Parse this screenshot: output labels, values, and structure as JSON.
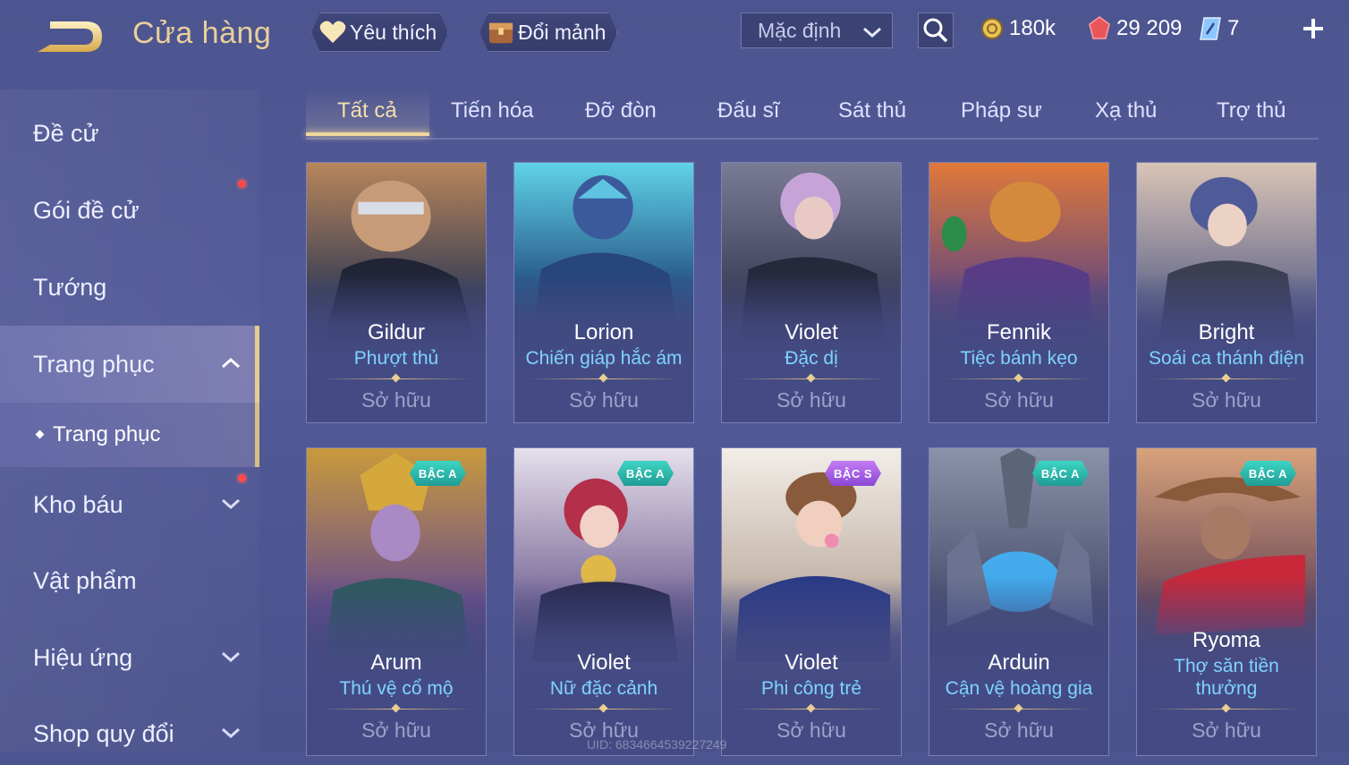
{
  "header": {
    "title": "Cửa hàng",
    "favorites_label": "Yêu thích",
    "exchange_label": "Đổi mảnh",
    "sort_value": "Mặc định",
    "currencies": [
      {
        "name": "gold",
        "value": "180k",
        "color": "#e9c35a"
      },
      {
        "name": "vouchers",
        "value": "29 209",
        "color": "#e8565a"
      },
      {
        "name": "tickets",
        "value": "7",
        "color": "#8ec7ff"
      }
    ]
  },
  "sidebar": {
    "items": [
      {
        "label": "Đề cử"
      },
      {
        "label": "Gói đề cử"
      },
      {
        "label": "Tướng"
      },
      {
        "label": "Trang phục"
      },
      {
        "label": "Kho báu"
      },
      {
        "label": "Vật phẩm"
      },
      {
        "label": "Hiệu ứng"
      },
      {
        "label": "Shop quy đổi"
      }
    ],
    "sub_item": "Trang phục"
  },
  "tabs": [
    "Tất cả",
    "Tiến hóa",
    "Đỡ đòn",
    "Đấu sĩ",
    "Sát thủ",
    "Pháp sư",
    "Xạ thủ",
    "Trợ thủ"
  ],
  "cards": [
    {
      "hero": "Gildur",
      "skin": "Phượt thủ",
      "status": "Sở hữu",
      "badge": ""
    },
    {
      "hero": "Lorion",
      "skin": "Chiến giáp hắc ám",
      "status": "Sở hữu",
      "badge": ""
    },
    {
      "hero": "Violet",
      "skin": "Đặc dị",
      "status": "Sở hữu",
      "badge": ""
    },
    {
      "hero": "Fennik",
      "skin": "Tiệc bánh kẹo",
      "status": "Sở hữu",
      "badge": ""
    },
    {
      "hero": "Bright",
      "skin": "Soái ca thánh điện",
      "status": "Sở hữu",
      "badge": ""
    },
    {
      "hero": "Arum",
      "skin": "Thú vệ cổ mộ",
      "status": "Sở hữu",
      "badge": "BẬC A"
    },
    {
      "hero": "Violet",
      "skin": "Nữ đặc cảnh",
      "status": "Sở hữu",
      "badge": "BẬC A"
    },
    {
      "hero": "Violet",
      "skin": "Phi công trẻ",
      "status": "Sở hữu",
      "badge": "BẬC S"
    },
    {
      "hero": "Arduin",
      "skin": "Cận vệ hoàng gia",
      "status": "Sở hữu",
      "badge": "BẬC A"
    },
    {
      "hero": "Ryoma",
      "skin_line1": "Thợ săn tiền",
      "skin_line2": "thưởng",
      "status": "Sở hữu",
      "badge": "BẬC A"
    }
  ],
  "footer": {
    "uid": "UID: 6834664539227249"
  }
}
